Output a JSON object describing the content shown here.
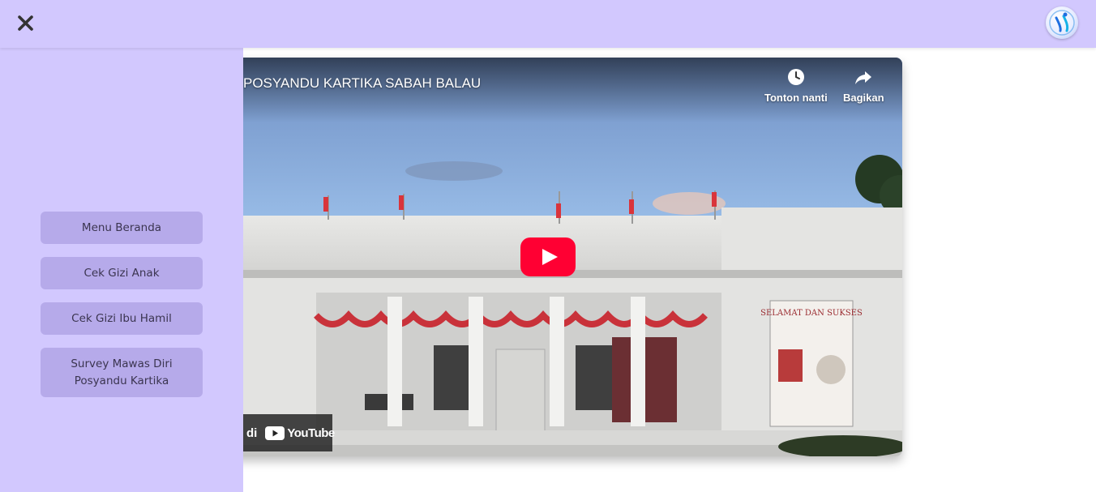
{
  "topbar": {
    "close_icon": "close-icon",
    "avatar_icon": "user-avatar"
  },
  "sidebar": {
    "items": [
      {
        "label": "Menu Beranda"
      },
      {
        "label": "Cek Gizi Anak"
      },
      {
        "label": "Cek Gizi Ibu Hamil"
      },
      {
        "label": "Survey Mawas Diri Posyandu Kartika"
      }
    ]
  },
  "video": {
    "title": "POSYANDU KARTIKA SABAH BALAU",
    "watch_later_label": "Tonton nanti",
    "share_label": "Bagikan",
    "watch_on_prefix": "di",
    "youtube_label": "YouTube",
    "banner_text": "SELAMAT DAN SUKSES"
  },
  "colors": {
    "header_bg": "#d2c8fe",
    "sidebar_bg": "#d2c8fe",
    "menu_button_bg": "#b6aaea",
    "play_button": "#ff0033"
  }
}
